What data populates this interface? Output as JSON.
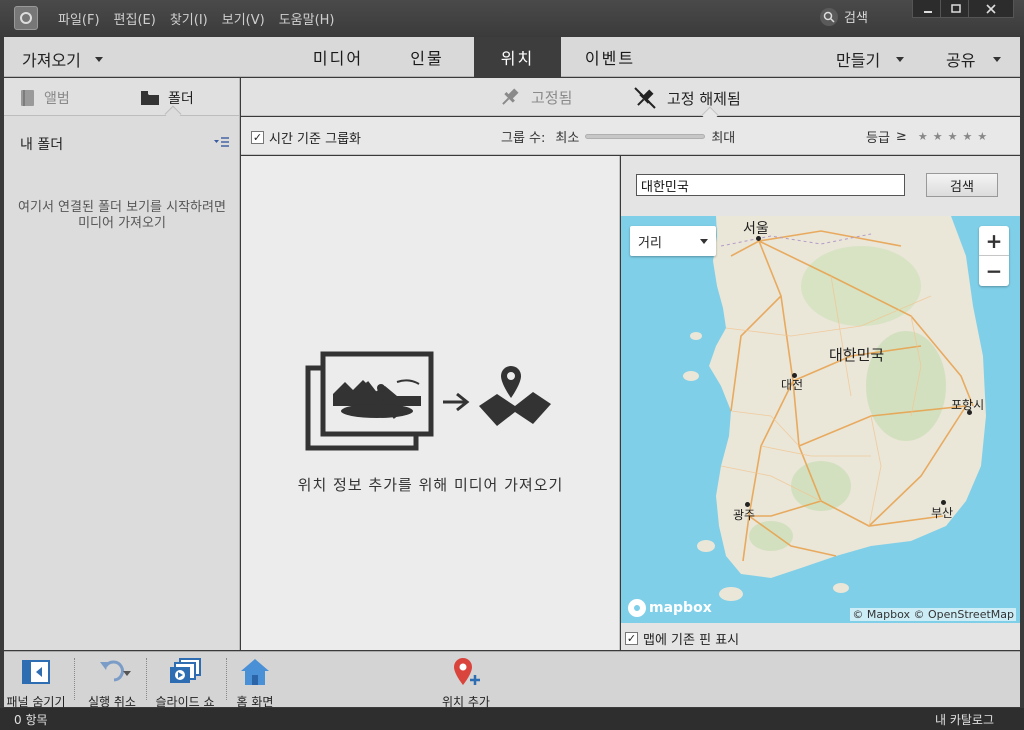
{
  "menu": {
    "file": "파일(F)",
    "edit": "편집(E)",
    "find": "찾기(I)",
    "view": "보기(V)",
    "help": "도움말(H)"
  },
  "titlebar": {
    "search_label": "검색"
  },
  "nav": {
    "import": "가져오기",
    "tabs": [
      "미디어",
      "인물",
      "위치",
      "이벤트"
    ],
    "active_tab": "위치",
    "create": "만들기",
    "share": "공유"
  },
  "left_panel": {
    "tab_album": "앨범",
    "tab_folder": "폴더",
    "my_folder": "내 폴더",
    "empty_message": "여기서 연결된 폴더 보기를 시작하려면미디어 가져오기"
  },
  "subheader": {
    "pinned": "고정됨",
    "unpinned": "고정 해제됨"
  },
  "filter": {
    "group_by_time": "시간 기준 그룹화",
    "group_by_time_checked": true,
    "group_count": "그룹 수:",
    "min": "최소",
    "max": "최대",
    "rating": "등급",
    "rating_op": "≥",
    "stars": 5
  },
  "content": {
    "message": "위치 정보 추가를 위해 미디어 가져오기"
  },
  "map": {
    "search_value": "대한민국",
    "search_button": "검색",
    "map_type": "거리",
    "zoom_in": "+",
    "zoom_out": "−",
    "labels": {
      "seoul": "서울",
      "country": "대한민국",
      "daejeon": "대전",
      "pohang": "포항시",
      "gwangju": "광주",
      "busan": "부산"
    },
    "logo": "mapbox",
    "attribution": "© Mapbox © OpenStreetMap",
    "show_existing_pins": "맵에 기존 핀 표시",
    "show_existing_pins_checked": true
  },
  "toolbar": {
    "hide_panel": "패널 숨기기",
    "undo": "실행 취소",
    "slideshow": "슬라이드 쇼",
    "home": "홈 화면",
    "add_location": "위치 추가"
  },
  "status": {
    "count": "0 항목",
    "catalog": "내 카탈로그"
  },
  "colors": {
    "active_tab_bg": "#3d3d3d",
    "map_water": "#7fcfe8",
    "map_land": "#eae6d8",
    "road": "#e8a04a",
    "pin": "#d9453d"
  }
}
